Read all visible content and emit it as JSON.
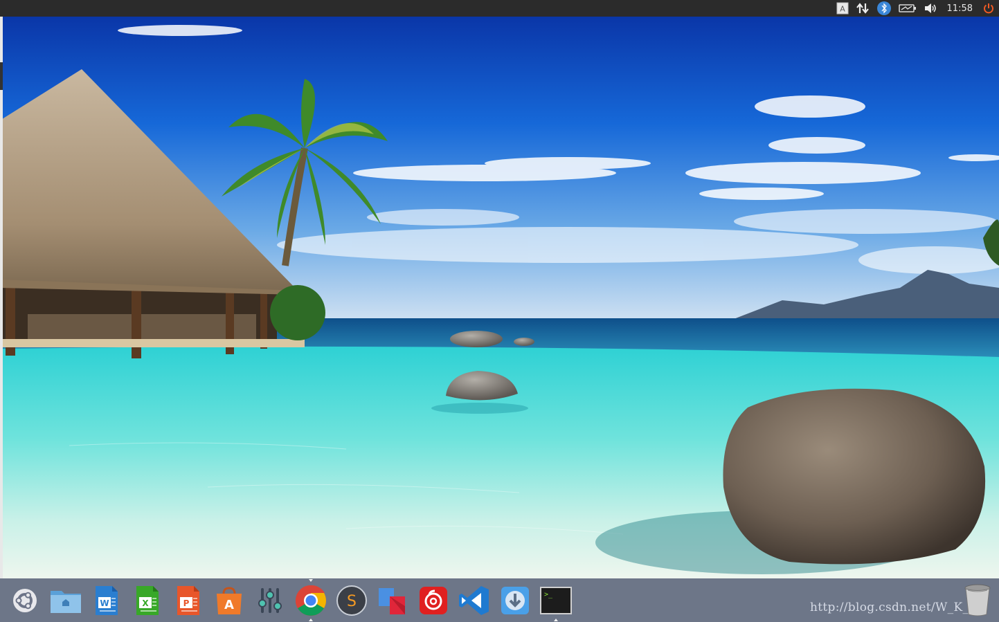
{
  "top_panel": {
    "clock": "11:58",
    "indicators": [
      {
        "name": "keyboard-layout-icon",
        "label": "A"
      },
      {
        "name": "network-icon"
      },
      {
        "name": "bluetooth-icon"
      },
      {
        "name": "battery-icon"
      },
      {
        "name": "volume-icon"
      },
      {
        "name": "power-icon"
      }
    ]
  },
  "dock": {
    "apps": [
      {
        "name": "ubuntu-dash-icon"
      },
      {
        "name": "files-icon"
      },
      {
        "name": "writer-icon",
        "glyph": "W"
      },
      {
        "name": "calc-icon",
        "glyph": "X"
      },
      {
        "name": "impress-icon",
        "glyph": "P"
      },
      {
        "name": "software-center-icon",
        "glyph": "A"
      },
      {
        "name": "settings-mixer-icon"
      },
      {
        "name": "chrome-icon"
      },
      {
        "name": "sublime-text-icon",
        "glyph": "S"
      },
      {
        "name": "app-n-icon"
      },
      {
        "name": "netease-music-icon"
      },
      {
        "name": "vscode-icon"
      },
      {
        "name": "download-icon"
      },
      {
        "name": "terminal-icon",
        "glyph": ">_"
      }
    ],
    "trash": "trash-icon"
  },
  "watermark": "http://blog.csdn.net/W_K_L",
  "colors": {
    "top_bar": "#2b2b2b",
    "dock": "#768094",
    "sky_top": "#0b3fb8",
    "water": "#3fd6cf",
    "sea": "#1a6fa0"
  }
}
